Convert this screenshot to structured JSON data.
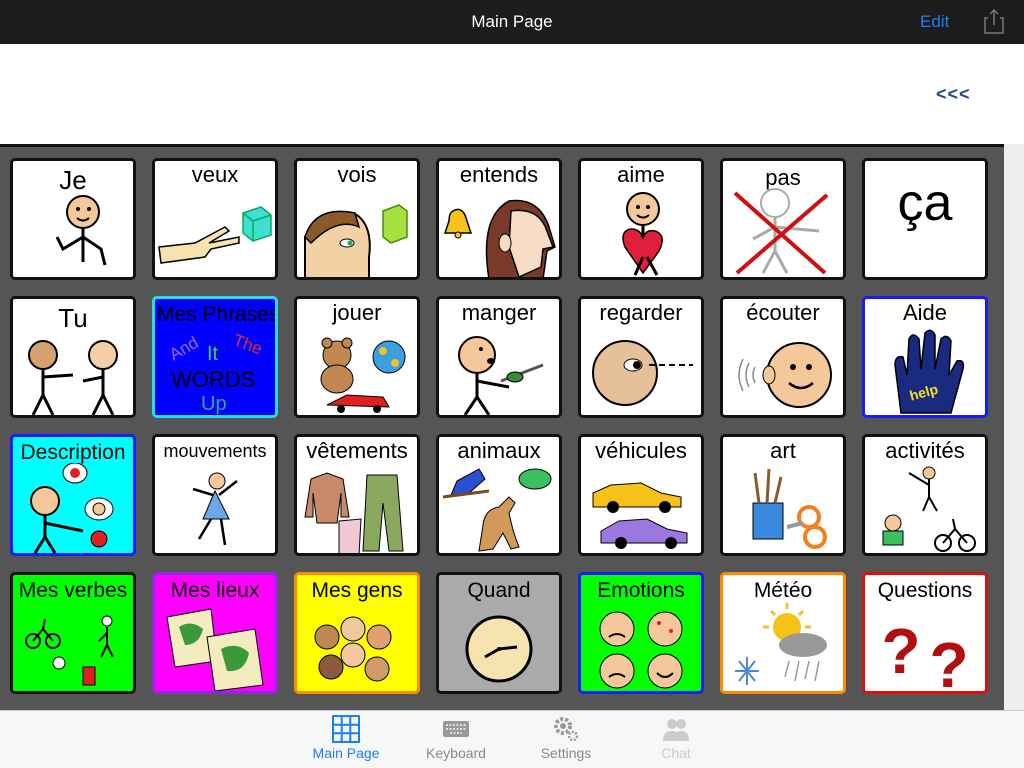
{
  "header": {
    "title": "Main Page",
    "edit_label": "Edit"
  },
  "message_bar": {
    "back_label": "<<<"
  },
  "tiles": [
    {
      "label": "Je",
      "border": "#f2d200",
      "bg": "#ffffff",
      "icon": "person-self-icon"
    },
    {
      "label": "veux",
      "border": "#22cc22",
      "bg": "#ffffff",
      "icon": "hand-want-icon"
    },
    {
      "label": "vois",
      "border": "#22cc22",
      "bg": "#ffffff",
      "icon": "boy-looking-icon"
    },
    {
      "label": "entends",
      "border": "#22cc22",
      "bg": "#ffffff",
      "icon": "girl-hearing-icon"
    },
    {
      "label": "aime",
      "border": "#22cc22",
      "bg": "#ffffff",
      "icon": "person-heart-icon"
    },
    {
      "label": "pas",
      "border": "#e01010",
      "bg": "#ffffff",
      "icon": "crossed-out-person-icon"
    },
    {
      "label": "ça",
      "border": "#111111",
      "bg": "#ffffff",
      "icon": "none"
    },
    {
      "label": "Tu",
      "border": "#f2d200",
      "bg": "#ffffff",
      "icon": "person-you-icon"
    },
    {
      "label": "Mes Phrases",
      "border": "#20e0e0",
      "bg": "#0000ff",
      "icon": "words-collage-icon"
    },
    {
      "label": "jouer",
      "border": "#22cc22",
      "bg": "#ffffff",
      "icon": "toys-icon"
    },
    {
      "label": "manger",
      "border": "#22cc22",
      "bg": "#ffffff",
      "icon": "person-eating-icon"
    },
    {
      "label": "regarder",
      "border": "#22cc22",
      "bg": "#ffffff",
      "icon": "head-looking-icon"
    },
    {
      "label": "écouter",
      "border": "#22cc22",
      "bg": "#ffffff",
      "icon": "head-listening-icon"
    },
    {
      "label": "Aide",
      "border": "#1a1aff",
      "bg": "#ffffff",
      "icon": "help-hand-icon"
    },
    {
      "label": "Description",
      "border": "#1a1aff",
      "bg": "#00ffff",
      "icon": "describe-icon"
    },
    {
      "label": "mouvements",
      "border": "#111111",
      "bg": "#ffffff",
      "icon": "dancing-girl-icon"
    },
    {
      "label": "vêtements",
      "border": "#111111",
      "bg": "#ffffff",
      "icon": "clothes-icon"
    },
    {
      "label": "animaux",
      "border": "#111111",
      "bg": "#ffffff",
      "icon": "animals-icon"
    },
    {
      "label": "véhicules",
      "border": "#111111",
      "bg": "#ffffff",
      "icon": "cars-icon"
    },
    {
      "label": "art",
      "border": "#111111",
      "bg": "#ffffff",
      "icon": "art-supplies-icon"
    },
    {
      "label": "activités",
      "border": "#111111",
      "bg": "#ffffff",
      "icon": "activities-icon"
    },
    {
      "label": "Mes verbes",
      "border": "#111111",
      "bg": "#00ff00",
      "icon": "verbs-icon"
    },
    {
      "label": "Mes lieux",
      "border": "#8a2be2",
      "bg": "#ff00ff",
      "icon": "maps-icon"
    },
    {
      "label": "Mes gens",
      "border": "#ff8c00",
      "bg": "#ffff00",
      "icon": "people-faces-icon"
    },
    {
      "label": "Quand",
      "border": "#111111",
      "bg": "#aaaaaa",
      "icon": "clock-icon"
    },
    {
      "label": "Emotions",
      "border": "#1a1aff",
      "bg": "#00ff00",
      "icon": "emotion-faces-icon"
    },
    {
      "label": "Météo",
      "border": "#ff8c00",
      "bg": "#ffffff",
      "icon": "weather-icon"
    },
    {
      "label": "Questions",
      "border": "#e01010",
      "bg": "#ffffff",
      "icon": "question-marks-icon"
    }
  ],
  "collage_words": [
    "And",
    "It",
    "The",
    "WORDS",
    "Up"
  ],
  "help_text": "help",
  "tabs": [
    {
      "label": "Main Page",
      "state": "active",
      "icon": "grid-icon"
    },
    {
      "label": "Keyboard",
      "state": "normal",
      "icon": "keyboard-icon"
    },
    {
      "label": "Settings",
      "state": "normal",
      "icon": "gear-icon"
    },
    {
      "label": "Chat",
      "state": "disabled",
      "icon": "chat-people-icon"
    }
  ]
}
